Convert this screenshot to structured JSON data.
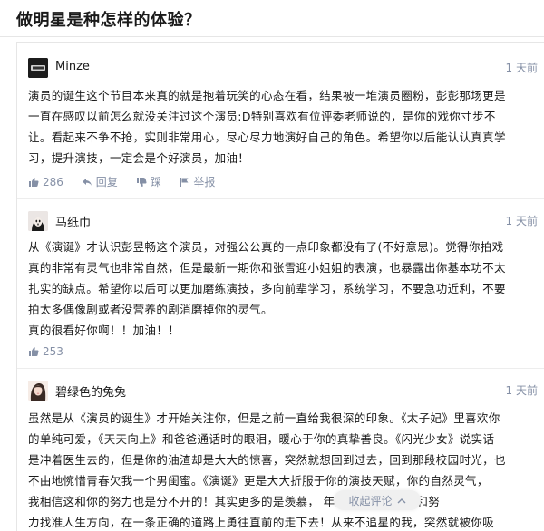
{
  "page": {
    "title": "做明星是种怎样的体验？"
  },
  "comments": [
    {
      "author": "Minze",
      "time": "1 天前",
      "lines": [
        "演员的诞生这个节目本来真的就是抱着玩笑的心态在看，结果被一堆演员圈粉，彭彭那场更是",
        "一直在感叹以前怎么就没关注过这个演员:D特别喜欢有位评委老师说的，是你的戏你寸步不",
        "让。看起来不争不抢，实则非常用心，尽心尽力地演好自己的角色。希望你以后能认认真真学",
        "习，提升演技，一定会是个好演员，加油！"
      ],
      "likes": "286",
      "reply_label": "回复",
      "dislike_label": "踩",
      "report_label": "举报"
    },
    {
      "author": "马纸巾",
      "time": "1 天前",
      "lines": [
        "从《演诞》才认识彭昱畅这个演员，对强公公真的一点印象都没有了(不好意思)。觉得你拍戏",
        "真的非常有灵气也非常自然，但是最新一期你和张雪迎小姐姐的表演，也暴露出你基本功不太",
        "扎实的缺点。希望你以后可以更加磨练演技，多向前辈学习，系统学习，不要急功近利，不要",
        "拍太多偶像剧或者没营养的剧消磨掉你的灵气。",
        "真的很看好你啊！！加油！！"
      ],
      "likes": "253"
    },
    {
      "author": "碧绿色的兔兔",
      "time": "1 天前",
      "lines": [
        "虽然是从《演员的诞生》才开始关注你，但是之前一直给我很深的印象。《太子妃》里喜欢你",
        "的单纯可爱，《天天向上》和爸爸通话时的眼泪，暖心于你的真挚善良。《闪光少女》说实话",
        "是冲着医生去的，但是你的油渣却是大大的惊喜，突然就想回到过去，回到那段校园时光，也",
        "不由地惋惜青春欠我一个男闺蜜。《演诞》更是大大折服于你的演技天赋，你的自然灵气，",
        "我相信这和你的努力也是分不开的！其实更多的是羡慕，                年纪就能凭借天赋和努",
        "力找准人生方向，在一条正确的道路上勇往直前的走下去！从来不追星的我，突然就被你吸"
      ]
    }
  ],
  "collapse_button": {
    "label": "收起评论"
  },
  "colors": {
    "meta": "#8590a6",
    "text": "#1a1a1a",
    "border": "#e6e6e6"
  }
}
